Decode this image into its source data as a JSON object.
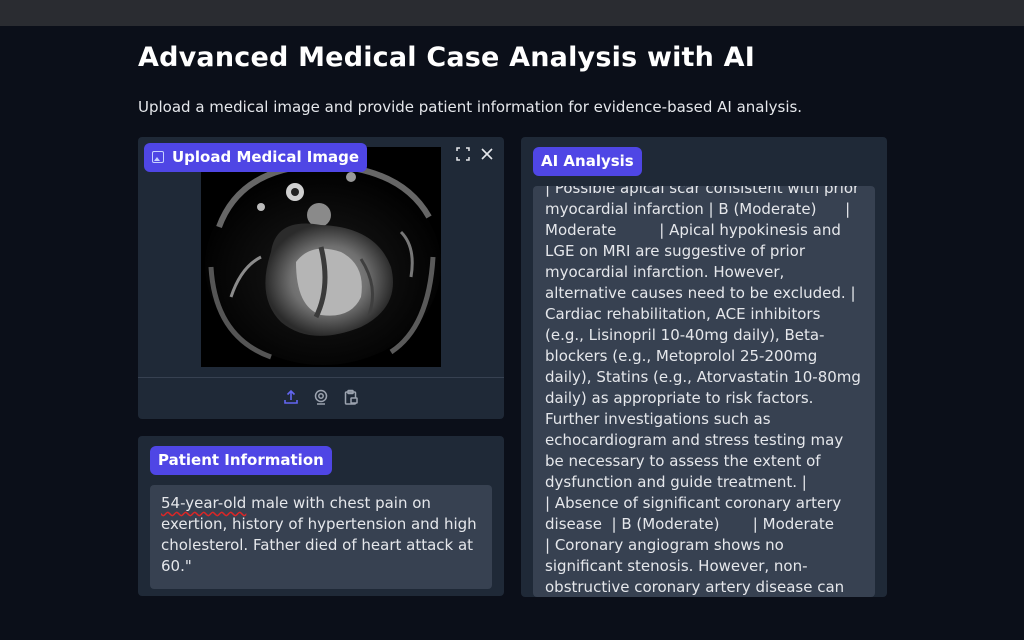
{
  "page": {
    "title": "Advanced Medical Case Analysis with AI",
    "subtitle": "Upload a medical image and provide patient information for evidence-based AI analysis."
  },
  "upload": {
    "label": "Upload Medical Image",
    "icon": "image-icon",
    "controls": [
      "fullscreen-icon",
      "close-icon"
    ],
    "toolbar": [
      "upload-icon",
      "webcam-icon",
      "clipboard-icon"
    ]
  },
  "patient": {
    "label": "Patient Information",
    "flagged_word": "54-year-old",
    "text_rest": " male with chest pain on exertion, history of hypertension and high cholesterol. Father died of heart attack at 60.\""
  },
  "analysis": {
    "label": "AI Analysis",
    "text": "| Possible apical scar consistent with prior myocardial infarction | B (Moderate)      | Moderate         | Apical hypokinesis and LGE on MRI are suggestive of prior myocardial infarction. However, alternative causes need to be excluded. | Cardiac rehabilitation, ACE inhibitors (e.g., Lisinopril 10-40mg daily), Beta-blockers (e.g., Metoprolol 25-200mg daily), Statins (e.g., Atorvastatin 10-80mg daily) as appropriate to risk factors.  Further investigations such as echocardiogram and stress testing may be necessary to assess the extent of dysfunction and guide treatment. |\n| Absence of significant coronary artery disease  | B (Moderate)       | Moderate\n| Coronary angiogram shows no significant stenosis. However, non-obstructive coronary artery disease can"
  },
  "colors": {
    "background": "#0b0f19",
    "panel": "#1f2937",
    "accent": "#4f46e5",
    "textbox": "#374151",
    "icon": "#6366f1"
  }
}
